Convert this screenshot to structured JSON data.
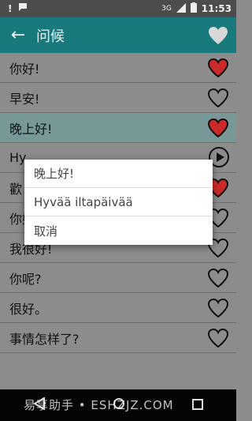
{
  "status_bar": {
    "network": "3G",
    "time": "11:53"
  },
  "app_bar": {
    "title": "问候"
  },
  "phrases": [
    {
      "text": "你好!",
      "favorite": true
    },
    {
      "text": "早安!",
      "favorite": false
    },
    {
      "text": "晚上好!",
      "favorite": true
    },
    {
      "text": "Hy",
      "favorite": false
    },
    {
      "text": "歡",
      "favorite": true
    },
    {
      "text": "你好吗?",
      "favorite": false
    },
    {
      "text": "我很好!",
      "favorite": false
    },
    {
      "text": "你呢?",
      "favorite": false
    },
    {
      "text": "很好。",
      "favorite": false
    },
    {
      "text": "事情怎样了?",
      "favorite": false
    }
  ],
  "popup": {
    "items": [
      "晚上好!",
      "Hyvää iltapäivää",
      "取消"
    ]
  },
  "watermark": "易享助手 • ESHZJZ.COM",
  "colors": {
    "appbar": "#197a7e",
    "heart_filled": "#cc2a2a"
  }
}
